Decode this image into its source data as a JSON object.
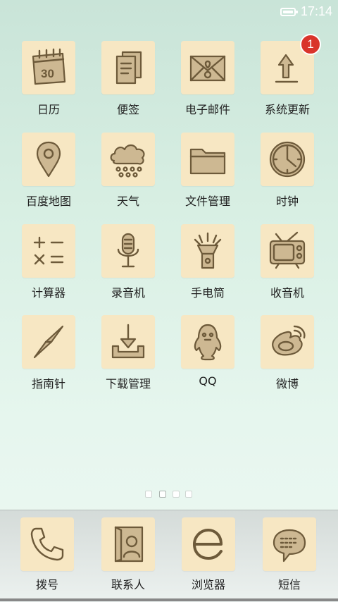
{
  "status_bar": {
    "time": "17:14"
  },
  "apps": [
    {
      "label": "日历",
      "icon": "calendar-icon",
      "day": "30"
    },
    {
      "label": "便签",
      "icon": "notes-icon"
    },
    {
      "label": "电子邮件",
      "icon": "email-icon"
    },
    {
      "label": "系统更新",
      "icon": "update-arrow-icon",
      "badge": "1"
    },
    {
      "label": "百度地图",
      "icon": "map-pin-icon"
    },
    {
      "label": "天气",
      "icon": "weather-cloud-icon"
    },
    {
      "label": "文件管理",
      "icon": "folder-icon"
    },
    {
      "label": "时钟",
      "icon": "clock-icon"
    },
    {
      "label": "计算器",
      "icon": "calculator-icon"
    },
    {
      "label": "录音机",
      "icon": "microphone-icon"
    },
    {
      "label": "手电筒",
      "icon": "flashlight-icon"
    },
    {
      "label": "收音机",
      "icon": "radio-tv-icon"
    },
    {
      "label": "指南针",
      "icon": "compass-needle-icon"
    },
    {
      "label": "下载管理",
      "icon": "download-icon"
    },
    {
      "label": "QQ",
      "icon": "qq-penguin-icon"
    },
    {
      "label": "微博",
      "icon": "weibo-icon"
    }
  ],
  "pager": {
    "page_count": 4,
    "current_page": 2
  },
  "dock": [
    {
      "label": "拨号",
      "icon": "phone-icon"
    },
    {
      "label": "联系人",
      "icon": "contacts-icon"
    },
    {
      "label": "浏览器",
      "icon": "browser-e-icon"
    },
    {
      "label": "短信",
      "icon": "message-bubble-icon"
    }
  ]
}
